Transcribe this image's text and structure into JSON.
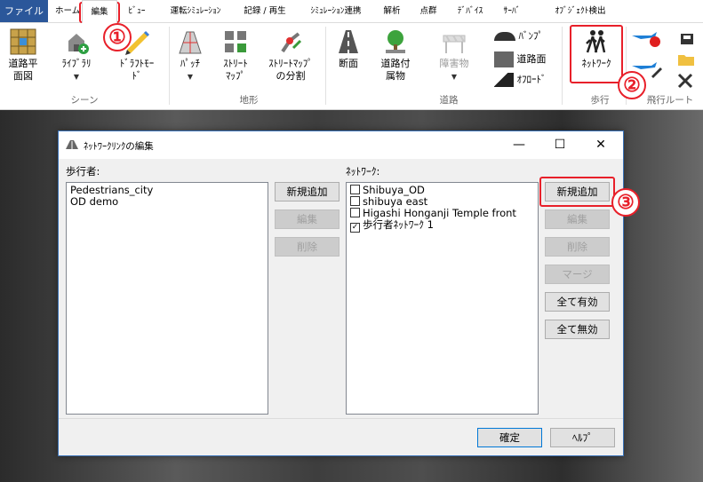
{
  "menu": {
    "file": "ファイル",
    "tabs": [
      "ホーム",
      "編集",
      "ﾋﾞｭｰ",
      "運転ｼﾐｭﾚｰｼｮﾝ",
      "記録 / 再生",
      "ｼﾐｭﾚｰｼｮﾝ連携",
      "解析",
      "点群",
      "ﾃﾞﾊﾞｲｽ",
      "ｻｰﾊﾞ",
      "ｵﾌﾞｼﾞｪｸﾄ検出"
    ]
  },
  "ribbon": {
    "road_plan": "道路平\n面図",
    "library": "ﾗｲﾌﾞﾗﾘ",
    "draft_mode": "ﾄﾞﾗﾌﾄﾓｰ\nﾄﾞ",
    "patch": "ﾊﾟｯﾁ",
    "street_map": "ｽﾄﾘｰﾄ\nﾏｯﾌﾟ",
    "street_map_split": "ｽﾄﾘｰﾄﾏｯﾌﾟ\nの分割",
    "cross_section": "断面",
    "road_attachment": "道路付\n属物",
    "obstacle": "障害物",
    "bump": "ﾊﾞﾝﾌﾟ",
    "road_surface": "道路面",
    "offroad": "ｵﾌﾛｰﾄﾞ",
    "network": "ﾈｯﾄﾜｰｸ",
    "groups": {
      "scene": "シーン",
      "terrain": "地形",
      "road": "道路",
      "pedestrian": "歩行",
      "flight_route": "飛行ルート"
    }
  },
  "annotations": [
    "①",
    "②",
    "③"
  ],
  "dialog": {
    "title": "ﾈｯﾄﾜｰｸﾘﾝｸの編集",
    "pedestrians_label": "歩行者:",
    "pedestrians": [
      "Pedestrians_city",
      "OD demo"
    ],
    "left_buttons": {
      "add": "新規追加",
      "edit": "編集",
      "delete": "削除"
    },
    "network_label": "ﾈｯﾄﾜｰｸ:",
    "networks": [
      {
        "name": "Shibuya_OD",
        "checked": false
      },
      {
        "name": "shibuya east",
        "checked": false
      },
      {
        "name": "Higashi Honganji Temple front",
        "checked": false
      },
      {
        "name": "歩行者ﾈｯﾄﾜｰｸ 1",
        "checked": true
      }
    ],
    "right_buttons": {
      "add": "新規追加",
      "edit": "編集",
      "delete": "削除",
      "merge": "マージ",
      "enable_all": "全て有効",
      "disable_all": "全て無効"
    },
    "ok": "確定",
    "help": "ﾍﾙﾌﾟ",
    "checkmark": "✓"
  }
}
